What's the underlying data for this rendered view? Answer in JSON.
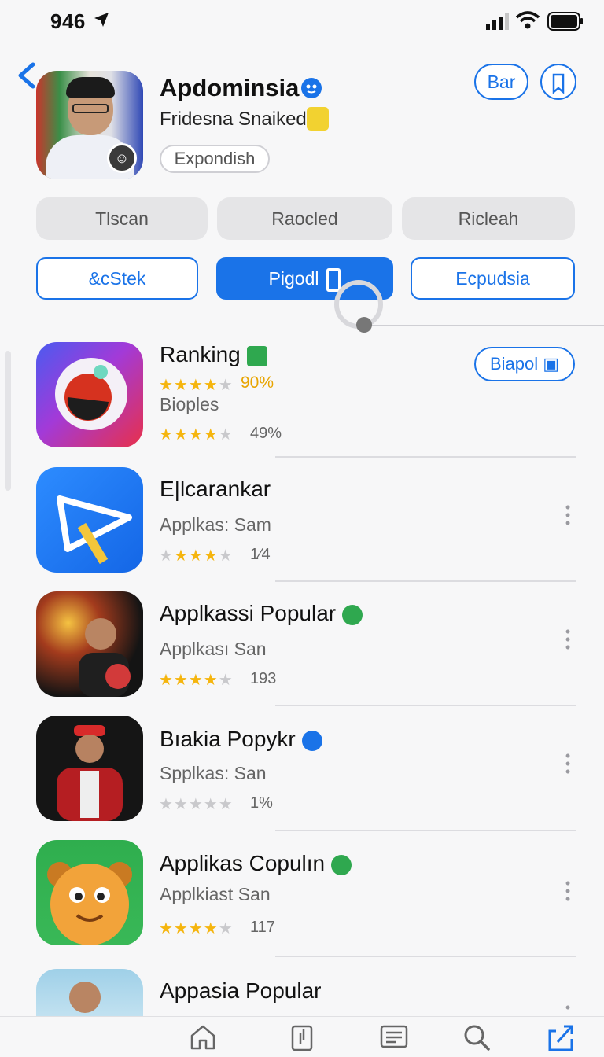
{
  "status_bar": {
    "time": "946"
  },
  "profile": {
    "name": "Apdominsia",
    "subtitle": "Fridesna Snaiked",
    "chip": "Expondish"
  },
  "header_buttons": {
    "bar_label": "Bar"
  },
  "filters_row1": [
    "Tlscan",
    "Raocled",
    "Ricleah"
  ],
  "filters_row2": {
    "left": "&cStek",
    "active": "Pigodl",
    "right": "Ecpudsia"
  },
  "get_button": {
    "label": "Biapol"
  },
  "apps": [
    {
      "title": "Ranking",
      "stat1": "90%",
      "subtitle": "Bioples",
      "rating": 4.5,
      "count": "49%",
      "badge_color": "#2fa84f"
    },
    {
      "title": "E|lcarankar",
      "subtitle": "Applkas: Sam",
      "rating": 4.5,
      "count": "1⁄4",
      "badge_color": ""
    },
    {
      "title": "Applkassi Popular",
      "subtitle": "Applkası San",
      "rating": 4.5,
      "count": "193",
      "badge_color": "#2fa84f"
    },
    {
      "title": "Bıakia Popykr",
      "subtitle": "Spplkas: San",
      "rating": 0,
      "count": "1%",
      "badge_color": "#1a73e8"
    },
    {
      "title": "Applikas Copulın",
      "subtitle": "Applkiast San",
      "rating": 4.5,
      "count": "117",
      "badge_color": "#2fa84f"
    },
    {
      "title": "Appasia Popular",
      "subtitle": "",
      "rating": 0,
      "count": "",
      "badge_color": ""
    }
  ],
  "icons": {
    "status": [
      "location-arrow-icon",
      "signal-icon",
      "wifi-icon",
      "battery-icon"
    ],
    "tabs": [
      "home-icon",
      "bookmark-icon",
      "news-icon",
      "search-icon",
      "share-icon"
    ]
  },
  "colors": {
    "accent": "#1a73e8",
    "star": "#f5b50e",
    "muted": "#666666"
  }
}
